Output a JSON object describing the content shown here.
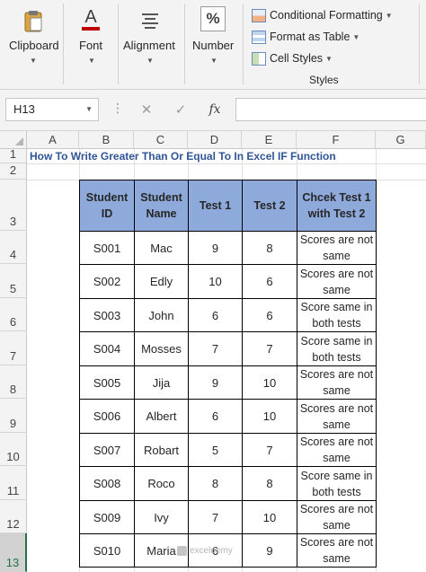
{
  "ribbon": {
    "clipboard": {
      "label": "Clipboard",
      "icon": "clipboard-icon"
    },
    "font": {
      "label": "Font",
      "icon_text": "A",
      "icon": "font-icon"
    },
    "alignment": {
      "label": "Alignment",
      "icon": "alignment-icon"
    },
    "number": {
      "label": "Number",
      "icon_text": "%",
      "icon": "percent-icon"
    },
    "styles": {
      "conditional_formatting": "Conditional Formatting",
      "format_as_table": "Format as Table",
      "cell_styles": "Cell Styles",
      "group_label": "Styles"
    }
  },
  "formula_bar": {
    "name_box": "H13",
    "fx_label": "fx",
    "formula": ""
  },
  "grid": {
    "columns": [
      "A",
      "B",
      "C",
      "D",
      "E",
      "F",
      "G"
    ],
    "rows": [
      "1",
      "2",
      "3",
      "4",
      "5",
      "6",
      "7",
      "8",
      "9",
      "10",
      "11",
      "12",
      "13"
    ],
    "selected_row": "13",
    "title": "How To Write Greater Than Or Equal To In Excel IF Function"
  },
  "table": {
    "headers": [
      {
        "line1": "Student",
        "line2": "ID"
      },
      {
        "line1": "Student",
        "line2": "Name"
      },
      {
        "line1": "Test 1",
        "line2": ""
      },
      {
        "line1": "Test 2",
        "line2": ""
      },
      {
        "line1": "Chcek Test 1",
        "line2": "with Test 2"
      }
    ],
    "rows": [
      {
        "id": "S001",
        "name": "Mac",
        "t1": "9",
        "t2": "8",
        "r1": "Scores are not",
        "r2": "same"
      },
      {
        "id": "S002",
        "name": "Edly",
        "t1": "10",
        "t2": "6",
        "r1": "Scores are not",
        "r2": "same"
      },
      {
        "id": "S003",
        "name": "John",
        "t1": "6",
        "t2": "6",
        "r1": "Score same in",
        "r2": "both tests"
      },
      {
        "id": "S004",
        "name": "Mosses",
        "t1": "7",
        "t2": "7",
        "r1": "Score same in",
        "r2": "both tests"
      },
      {
        "id": "S005",
        "name": "Jija",
        "t1": "9",
        "t2": "10",
        "r1": "Scores are not",
        "r2": "same"
      },
      {
        "id": "S006",
        "name": "Albert",
        "t1": "6",
        "t2": "10",
        "r1": "Scores are not",
        "r2": "same"
      },
      {
        "id": "S007",
        "name": "Robart",
        "t1": "5",
        "t2": "7",
        "r1": "Scores are not",
        "r2": "same"
      },
      {
        "id": "S008",
        "name": "Roco",
        "t1": "8",
        "t2": "8",
        "r1": "Score same in",
        "r2": "both tests"
      },
      {
        "id": "S009",
        "name": "Ivy",
        "t1": "7",
        "t2": "10",
        "r1": "Scores are not",
        "r2": "same"
      },
      {
        "id": "S010",
        "name": "Maria",
        "t1": "6",
        "t2": "9",
        "r1": "Scores are not",
        "r2": "same"
      }
    ]
  },
  "watermark": "exceldemy",
  "colors": {
    "header_fill": "#8eaadb",
    "title_text": "#2f5597",
    "selection": "#217346"
  }
}
